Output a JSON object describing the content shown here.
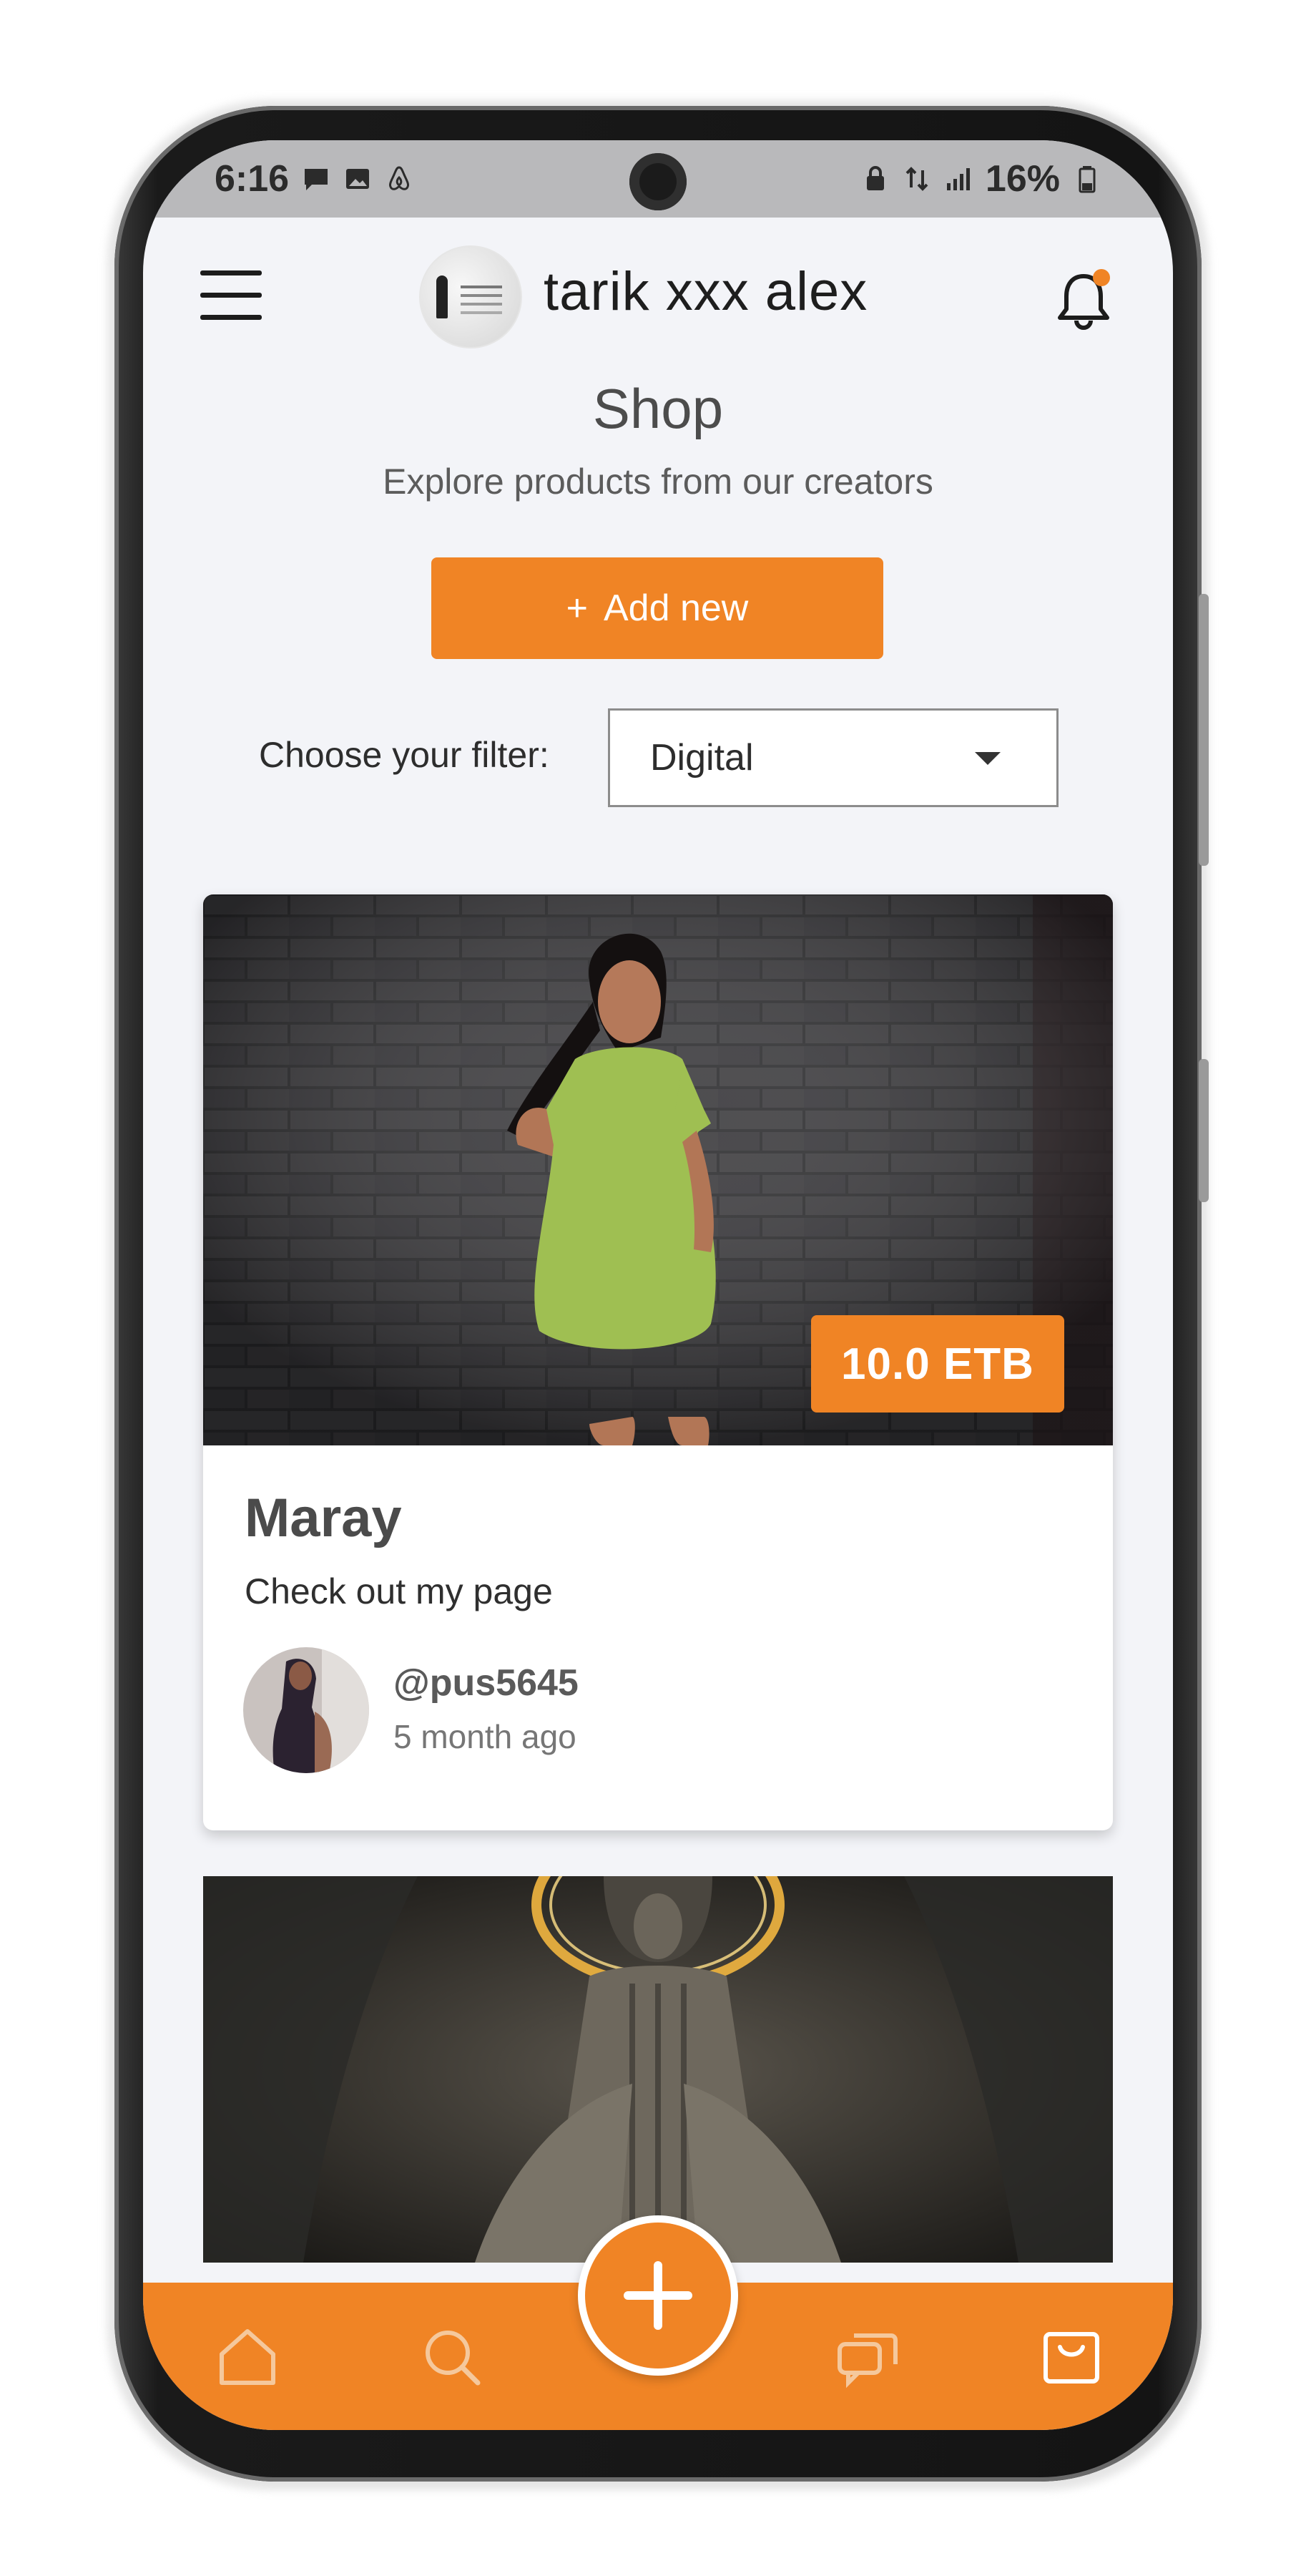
{
  "status_bar": {
    "time": "6:16",
    "battery": "16%"
  },
  "header": {
    "user_name": "tarik xxx alex"
  },
  "shop": {
    "title": "Shop",
    "subtitle": "Explore products from our creators",
    "add_button_label": "Add new",
    "add_button_icon": "+",
    "filter_label": "Choose your filter:",
    "filter_value": "Digital"
  },
  "products": [
    {
      "title": "Maray",
      "description": "Check out my page",
      "price": "10.0 ETB",
      "seller_handle": "@pus5645",
      "posted": "5 month ago"
    }
  ],
  "nav": {
    "items": [
      "home-icon",
      "search-icon",
      "add-icon",
      "chat-icon",
      "shopping-bag-icon"
    ],
    "accent_color": "#f08425"
  }
}
